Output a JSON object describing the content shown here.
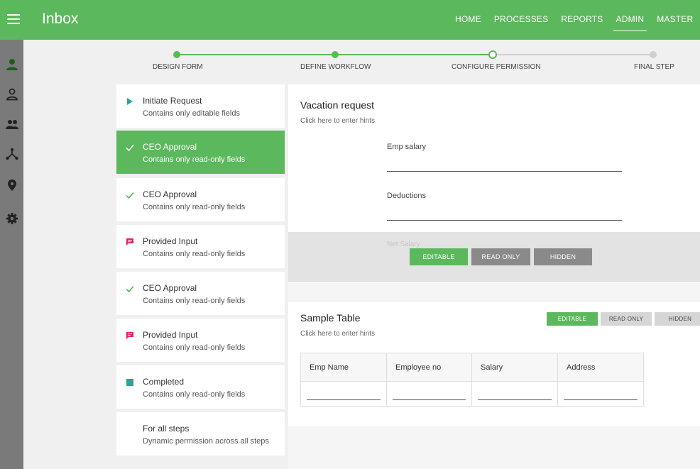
{
  "header": {
    "title": "Inbox",
    "nav": [
      "HOME",
      "PROCESSES",
      "REPORTS",
      "ADMIN",
      "MASTER"
    ],
    "active_nav": "ADMIN"
  },
  "colors": {
    "brand": "#5cb85c",
    "rail": "#7a7a7a",
    "step_active_icon": "#2e7d32",
    "provided_input_icon": "#e91e63",
    "completed_icon": "#26a69a"
  },
  "rail_icons": [
    "person-icon",
    "person-outline-icon",
    "group-icon",
    "workflow-icon",
    "location-icon",
    "settings-icon"
  ],
  "stepper": {
    "steps": [
      "DESIGN FORM",
      "DEFINE WORKFLOW",
      "CONFIGURE PERMISSION",
      "FINAL STEP"
    ],
    "current": "CONFIGURE PERMISSION"
  },
  "steps": [
    {
      "title": "Initiate Request",
      "sub": "Contains only editable fields",
      "icon": "play-icon"
    },
    {
      "title": "CEO Approval",
      "sub": "Contains only read-only fields",
      "icon": "check-icon",
      "active": true
    },
    {
      "title": "CEO Approval",
      "sub": "Contains only read-only fields",
      "icon": "check-icon"
    },
    {
      "title": "Provided Input",
      "sub": "Contains only read-only fields",
      "icon": "comment-icon"
    },
    {
      "title": "CEO Approval",
      "sub": "Contains only read-only fields",
      "icon": "check-icon"
    },
    {
      "title": "Provided Input",
      "sub": "Contains only read-only fields",
      "icon": "comment-icon"
    },
    {
      "title": "Completed",
      "sub": "Contains only read-only fields",
      "icon": "square-icon"
    },
    {
      "title": "For all steps",
      "sub": "Dynamic permission across all steps",
      "icon": ""
    }
  ],
  "form": {
    "title": "Vacation request",
    "hint": "Click here to enter hints",
    "fields": [
      "Emp salary",
      "Deductions",
      "Net Salary"
    ],
    "buttons": {
      "editable": "EDITABLE",
      "read_only": "READ ONLY",
      "hidden": "HIDDEN"
    }
  },
  "table": {
    "title": "Sample Table",
    "hint": "Click here to enter hints",
    "buttons": {
      "editable": "EDITABLE",
      "read_only": "READ ONLY",
      "hidden": "HIDDEN"
    },
    "columns": [
      "Emp Name",
      "Employee no",
      "Salary",
      "Address"
    ]
  }
}
